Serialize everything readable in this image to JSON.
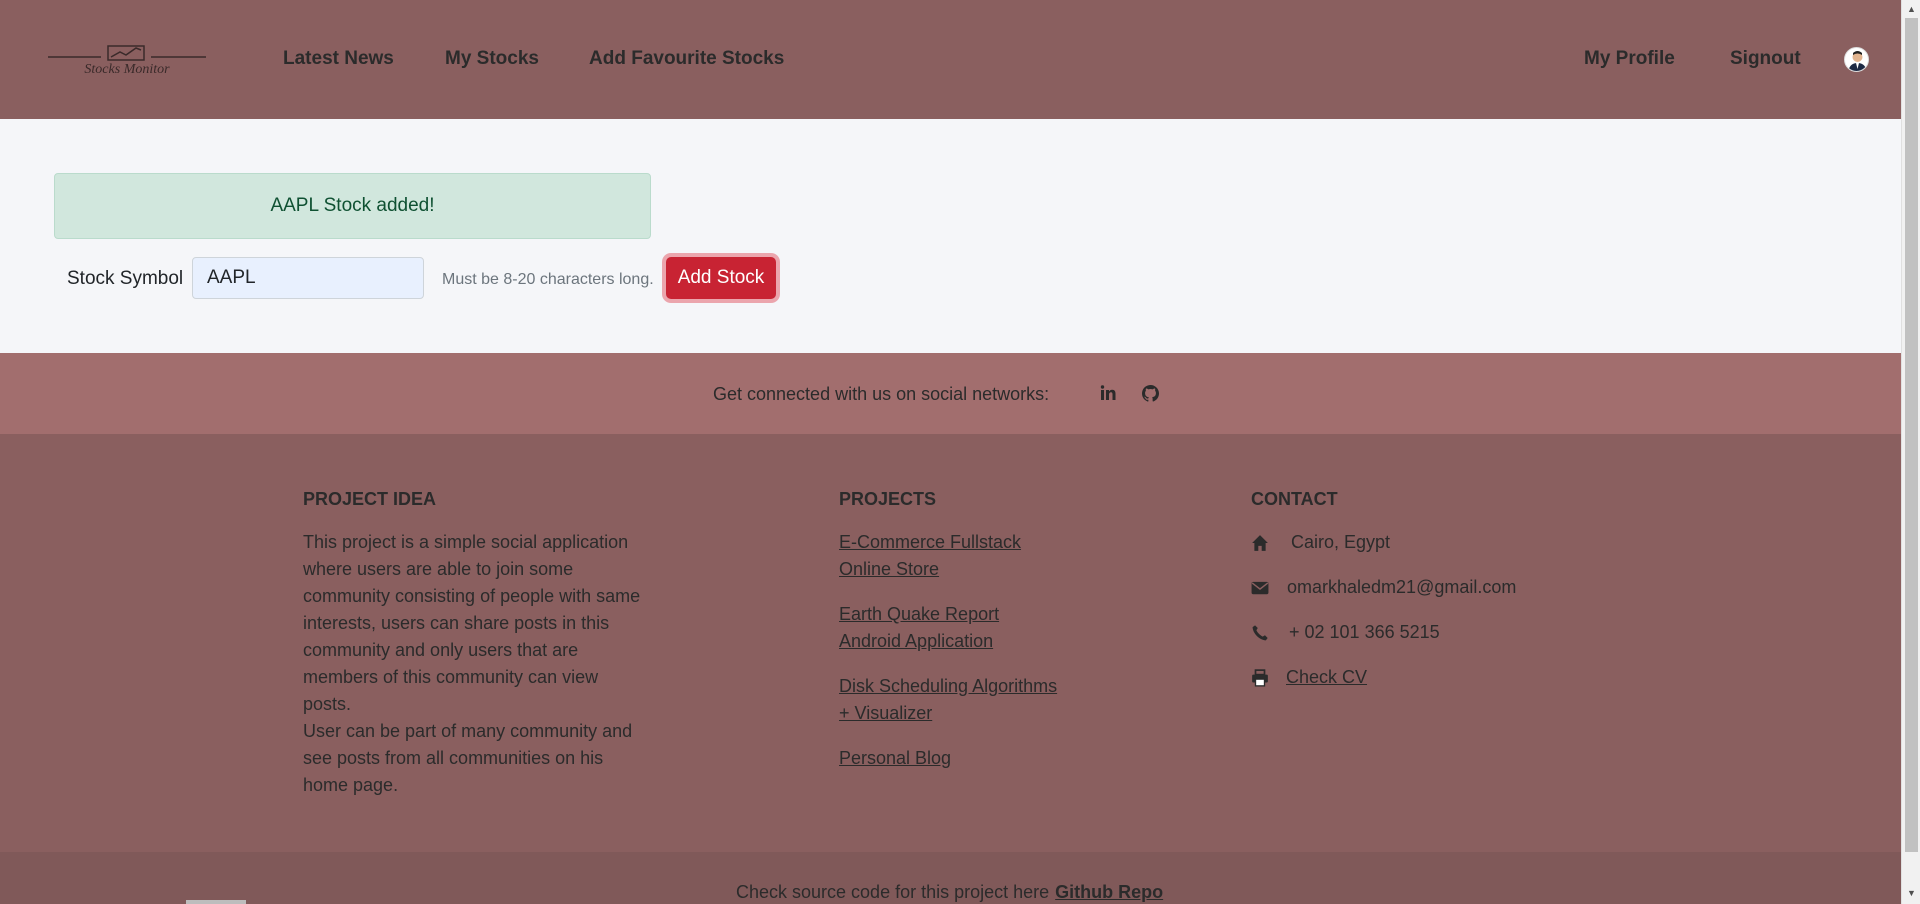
{
  "nav": {
    "logo_text": "Stocks Monitor",
    "links": [
      "Latest News",
      "My Stocks",
      "Add Favourite Stocks"
    ],
    "right_links": [
      "My Profile",
      "Signout"
    ]
  },
  "alert": {
    "message": "AAPL Stock added!"
  },
  "form": {
    "label": "Stock Symbol",
    "value": "AAPL",
    "hint": "Must be 8-20 characters long.",
    "button": "Add Stock"
  },
  "social": {
    "text": "Get connected with us on social networks:",
    "icons": [
      "linkedin-icon",
      "github-icon"
    ]
  },
  "footer": {
    "project_idea": {
      "title": "PROJECT IDEA",
      "lines": [
        "This project is a simple social application",
        "where users are able to join some",
        "community consisting of people with same",
        "interests, users can share posts in this",
        "community and only users that are",
        "members of this community can view",
        "posts.",
        "User can be part of many community and",
        "see posts from all communities on his",
        "home page."
      ]
    },
    "projects": {
      "title": "PROJECTS",
      "items": [
        [
          "E-Commerce Fullstack",
          "Online Store"
        ],
        [
          "Earth Quake Report",
          "Android Application"
        ],
        [
          "Disk Scheduling Algorithms",
          "+ Visualizer"
        ],
        [
          "Personal Blog"
        ]
      ]
    },
    "contact": {
      "title": "CONTACT",
      "address": "Cairo, Egypt",
      "email": "omarkhaledm21@gmail.com",
      "phone": "+ 02 101 366 5215",
      "cv": "Check CV"
    }
  },
  "bottom": {
    "text": "Check source code for this project here",
    "link": "Github Repo"
  },
  "colors": {
    "navbar": "#8a5f5f",
    "social_bar": "#a26e6e",
    "alert_bg": "#d1e7dd",
    "button": "#c82333"
  }
}
